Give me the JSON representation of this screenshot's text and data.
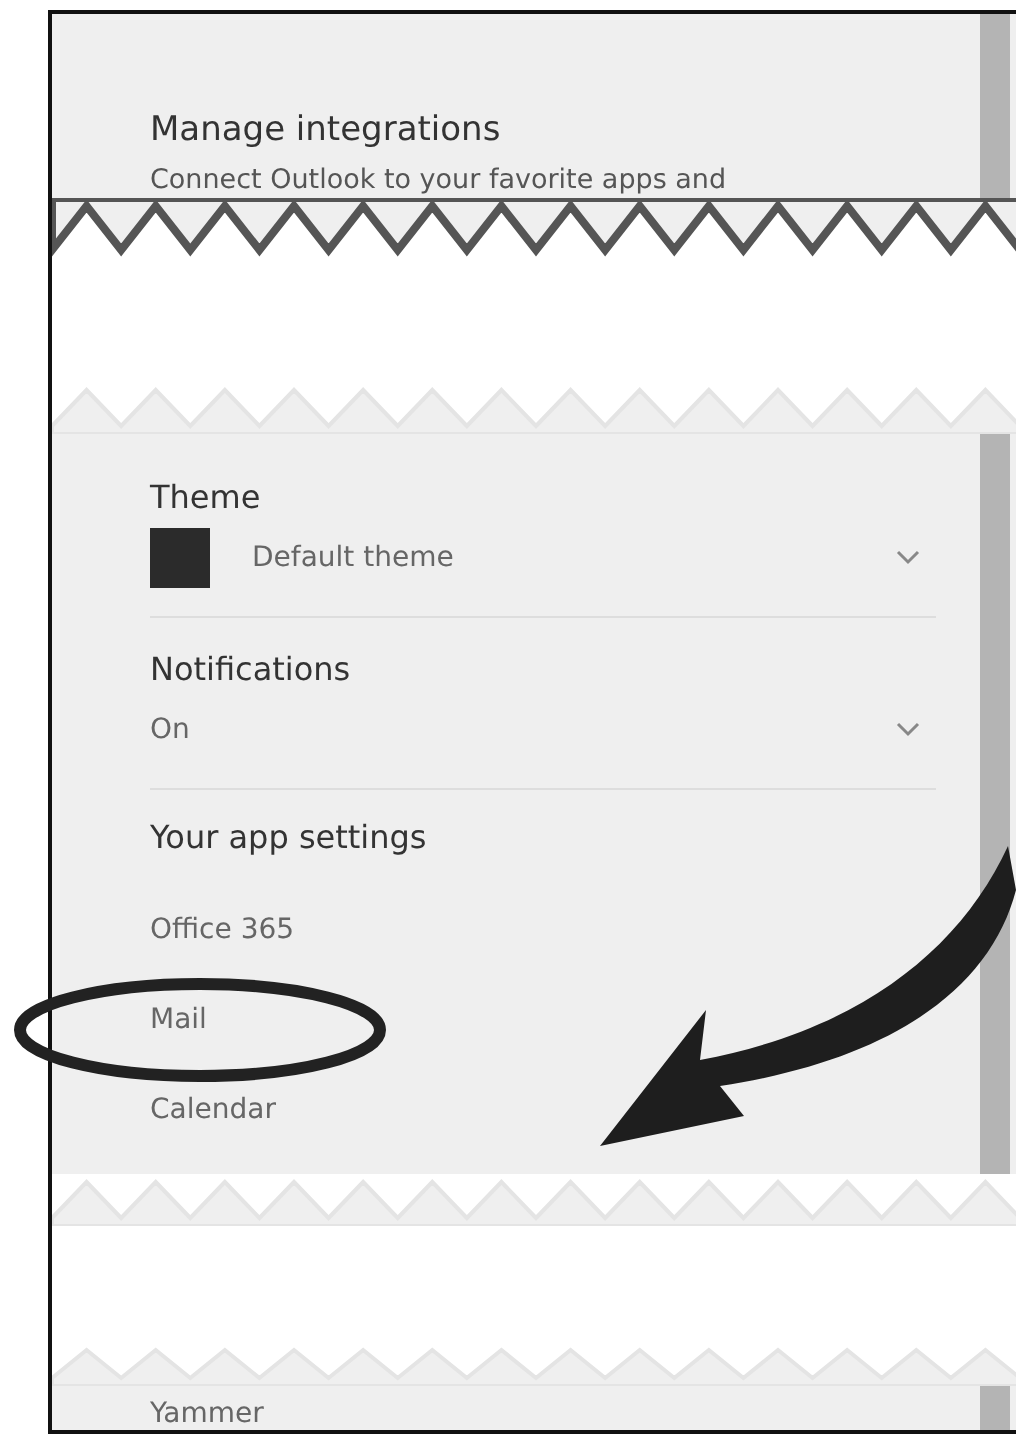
{
  "integrations": {
    "title": "Manage integrations",
    "description": "Connect Outlook to your favorite apps and"
  },
  "settings": [
    {
      "kind": "theme",
      "label": "Theme",
      "value": "Default theme"
    },
    {
      "kind": "select",
      "label": "Notifications",
      "value": "On"
    }
  ],
  "app_settings": {
    "heading": "Your app settings",
    "items": [
      {
        "label": "Office 365",
        "circled": false
      },
      {
        "label": "Mail",
        "circled": true
      },
      {
        "label": "Calendar",
        "circled": false
      }
    ]
  },
  "after_tear": [
    {
      "label": "Yammer"
    }
  ]
}
